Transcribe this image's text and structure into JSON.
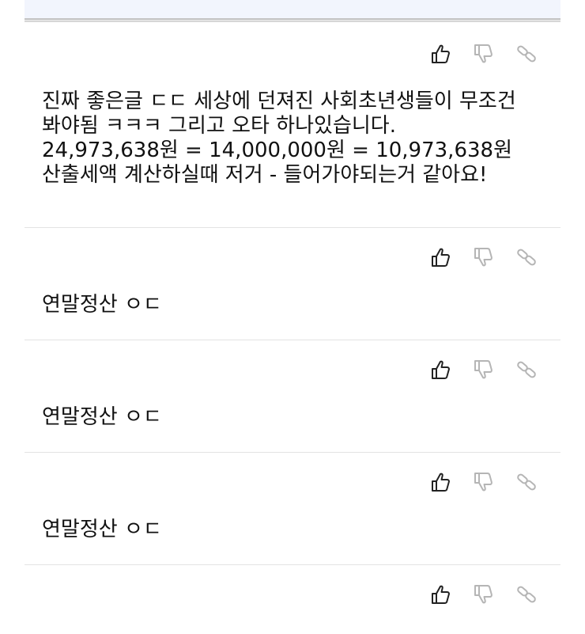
{
  "actions": {
    "like_icon": "thumbs-up-icon",
    "dislike_icon": "thumbs-down-icon",
    "link_icon": "link-icon"
  },
  "comments": [
    {
      "text": "진짜 좋은글 ㄷㄷ 세상에 던져진 사회초년생들이 무조건 봐야됨 ㅋㅋㅋ 그리고 오타 하나있습니다.\n24,973,638원 = 14,000,000원 = 10,973,638원\n산출세액 계산하실때 저거 - 들어가야되는거 같아요!"
    },
    {
      "text": "연말정산 ㅇㄷ"
    },
    {
      "text": "연말정산 ㅇㄷ"
    },
    {
      "text": "연말정산 ㅇㄷ"
    },
    {
      "text": ""
    }
  ]
}
